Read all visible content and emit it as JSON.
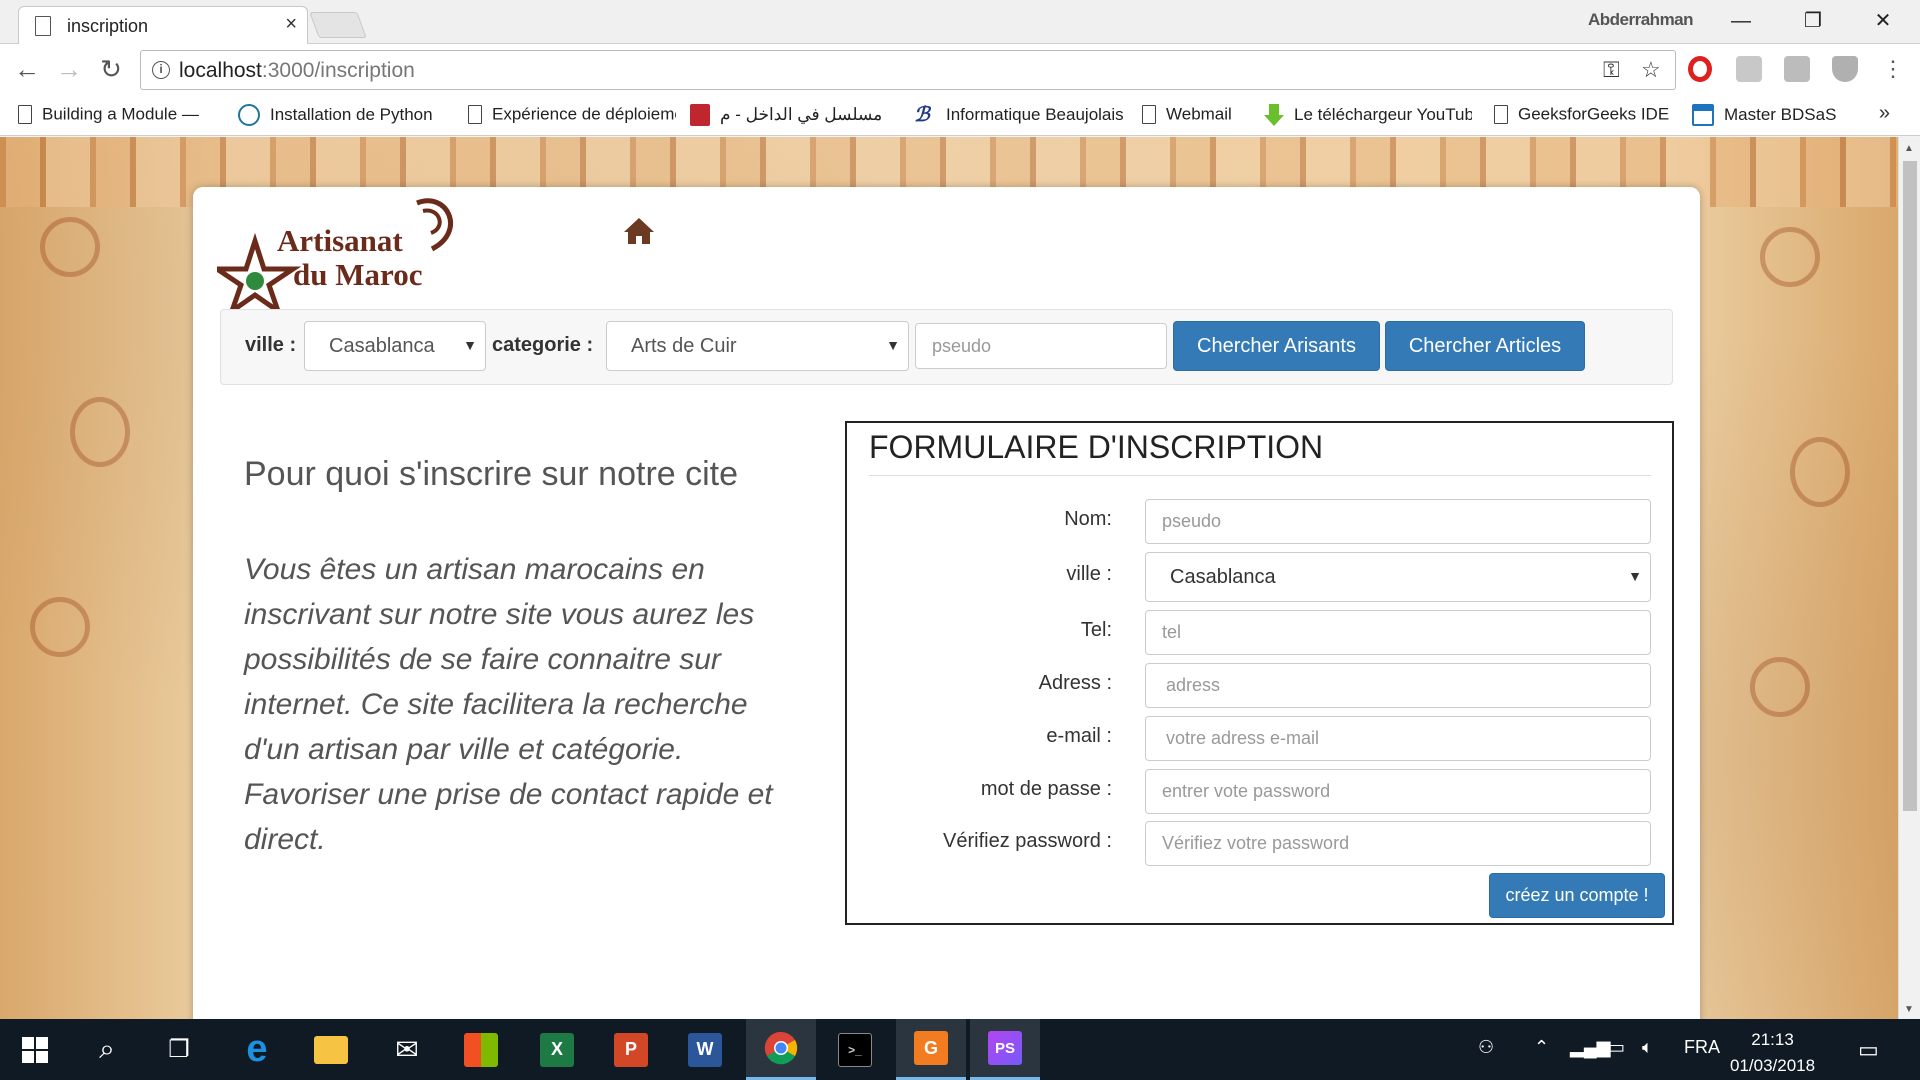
{
  "browser": {
    "tab_title": "inscription",
    "tab_close": "×",
    "profile_name": "Abderrahman",
    "window_controls": {
      "minimize": "—",
      "restore": "❐",
      "close": "✕"
    },
    "url_host": "localhost",
    "url_path": ":3000/inscription",
    "nav": {
      "back": "←",
      "forward": "→",
      "reload": "↻"
    }
  },
  "bookmarks": [
    {
      "label": "Building a Module —",
      "icon": "page-icon"
    },
    {
      "label": "Installation de Python",
      "icon": "wordpress-icon"
    },
    {
      "label": "Expérience de déploiement",
      "icon": "page-icon"
    },
    {
      "label": "مسلسل في الداخل - م",
      "icon": "heart-shield-icon"
    },
    {
      "label": "Informatique Beaujolais",
      "icon": "b-logo-icon"
    },
    {
      "label": "Webmail",
      "icon": "page-icon"
    },
    {
      "label": "Le téléchargeur YouTube",
      "icon": "download-arrow-icon"
    },
    {
      "label": "GeeksforGeeks IDE",
      "icon": "page-icon"
    },
    {
      "label": "Master BDSaS",
      "icon": "window-icon"
    }
  ],
  "bookmarks_more": "»",
  "site": {
    "logo_line1": "Artisanat",
    "logo_line2": "du Maroc",
    "search": {
      "ville_label": "ville :",
      "ville_value": "Casablanca",
      "categorie_label": "categorie :",
      "categorie_value": "Arts de Cuir",
      "pseudo_placeholder": "pseudo",
      "btn_artisans": "Chercher Arisants",
      "btn_articles": "Chercher Articles"
    },
    "left_heading": "Pour quoi s'inscrire sur notre cite",
    "left_paragraph": "Vous êtes un artisan marocains en inscrivant sur notre site vous aurez les possibilités de se faire connaitre sur internet. Ce site facilitera la recherche d'un artisan par ville et catégorie. Favoriser une prise de contact rapide et direct.",
    "form": {
      "title": "FORMULAIRE D'INSCRIPTION",
      "nom_label": "Nom:",
      "nom_placeholder": "pseudo",
      "ville_label": "ville :",
      "ville_value": "Casablanca",
      "tel_label": "Tel:",
      "tel_placeholder": "tel",
      "adress_label": "Adress :",
      "adress_placeholder": "adress",
      "email_label": "e-mail :",
      "email_placeholder": "votre adress e-mail",
      "password_label": "mot de passe :",
      "password_placeholder": "entrer vote password",
      "verify_label": "Vérifiez password :",
      "verify_placeholder": "Vérifiez votre password",
      "submit": "créez un compte !"
    }
  },
  "taskbar": {
    "language": "FRA",
    "time": "21:13",
    "date": "01/03/2018"
  },
  "colors": {
    "primary": "#337ab7",
    "logo": "#6b2b1a",
    "taskbar": "#101a24"
  }
}
